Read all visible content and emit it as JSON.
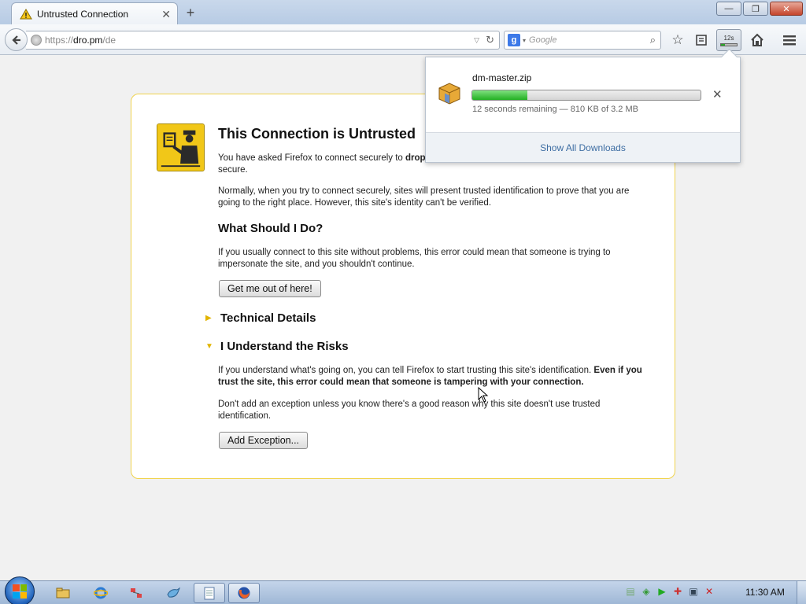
{
  "browser": {
    "tab": {
      "title": "Untrusted Connection",
      "close": "✕"
    },
    "new_tab": "+",
    "window_buttons": {
      "minimize": "—",
      "maximize": "❐",
      "close": "✕"
    },
    "url": {
      "scheme": "https://",
      "host": "dro.pm",
      "path": "/de"
    },
    "search": {
      "engine": "g",
      "placeholder": "Google"
    },
    "download_button": {
      "time": "12s",
      "progress": 0.24
    }
  },
  "error_page": {
    "title": "This Connection is Untrusted",
    "intro_prefix": "You have asked Firefox to connect securely to ",
    "intro_bold": "drop",
    "intro_suffix": "",
    "intro_tail": "secure.",
    "normally": "Normally, when you try to connect securely, sites will present trusted identification to prove that you are going to the right place. However, this site's identity can't be verified.",
    "what_heading": "What Should I Do?",
    "what_text": "If you usually connect to this site without problems, this error could mean that someone is trying to impersonate the site, and you shouldn't continue.",
    "get_out_button": "Get me out of here!",
    "tech_details": "Technical Details",
    "understand": "I Understand the Risks",
    "understand_text": "If you understand what's going on, you can tell Firefox to start trusting this site's identification. ",
    "understand_bold": "Even if you trust the site, this error could mean that someone is tampering with your connection.",
    "exception_text": "Don't add an exception unless you know there's a good reason why this site doesn't use trusted identification.",
    "add_exception_button": "Add Exception..."
  },
  "downloads_panel": {
    "file_name": "dm-master.zip",
    "progress": 0.24,
    "status": "12 seconds remaining — 810 KB of 3.2 MB",
    "cancel": "✕",
    "show_all": "Show All Downloads"
  },
  "taskbar": {
    "clock": "11:30 AM"
  },
  "colors": {
    "accent_yellow": "#f0d34c",
    "progress_green": "#22b022",
    "link_blue": "#3e6ea3"
  }
}
